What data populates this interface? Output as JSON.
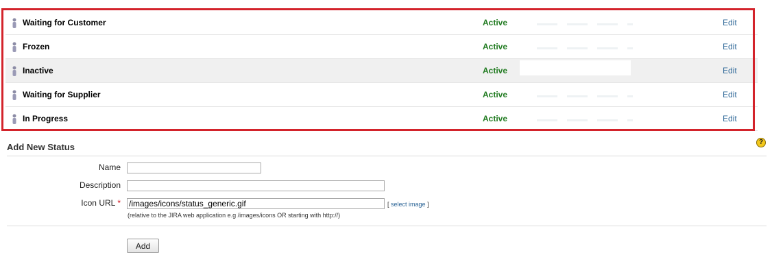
{
  "statuses": [
    {
      "name": "Waiting for Customer",
      "state": "Active",
      "action": "Edit"
    },
    {
      "name": "Frozen",
      "state": "Active",
      "action": "Edit"
    },
    {
      "name": "Inactive",
      "state": "Active",
      "action": "Edit"
    },
    {
      "name": "Waiting for Supplier",
      "state": "Active",
      "action": "Edit"
    },
    {
      "name": "In Progress",
      "state": "Active",
      "action": "Edit"
    }
  ],
  "add_section": {
    "title": "Add New Status",
    "help_icon": "question-mark-icon",
    "name_label": "Name",
    "name_value": "",
    "description_label": "Description",
    "description_value": "",
    "icon_url_label": "Icon URL",
    "required_marker": "*",
    "icon_url_value": "/images/icons/status_generic.gif",
    "select_image_open": "[",
    "select_image_label": "select image",
    "select_image_close": "]",
    "hint": "(relative to the JIRA web application e.g /images/icons OR starting with http://)",
    "add_button": "Add"
  },
  "colors": {
    "active": "#217b21",
    "link": "#336b9a",
    "highlight_border": "#d3232b",
    "alt_row": "#f0f0f0"
  }
}
